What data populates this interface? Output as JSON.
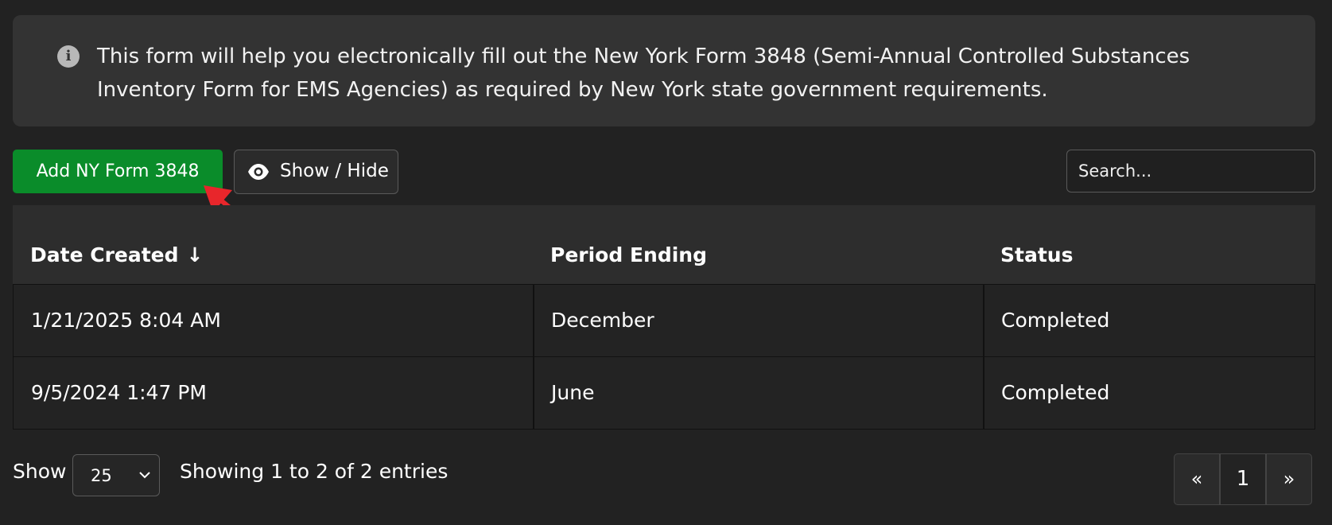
{
  "info": {
    "text": "This form will help you electronically fill out the New York Form 3848 (Semi-Annual Controlled Substances Inventory Form for EMS Agencies) as required by New York state government requirements.",
    "icon": "info-icon"
  },
  "toolbar": {
    "add_label": "Add NY Form 3848",
    "show_hide_label": "Show / Hide",
    "search_placeholder": "Search..."
  },
  "colors": {
    "add_button": "#0a8c2a",
    "annotation_arrow": "#e8262b"
  },
  "table": {
    "columns": [
      "Date Created",
      "Period Ending",
      "Status"
    ],
    "sort_indicator": "↓",
    "rows": [
      [
        "1/21/2025 8:04 AM",
        "December",
        "Completed"
      ],
      [
        "9/5/2024 1:47 PM",
        "June",
        "Completed"
      ]
    ]
  },
  "footer": {
    "show_label": "Show",
    "page_size": "25",
    "entries_text": "Showing 1 to 2 of 2 entries",
    "pagination": {
      "prev": "«",
      "current": "1",
      "next": "»"
    }
  }
}
